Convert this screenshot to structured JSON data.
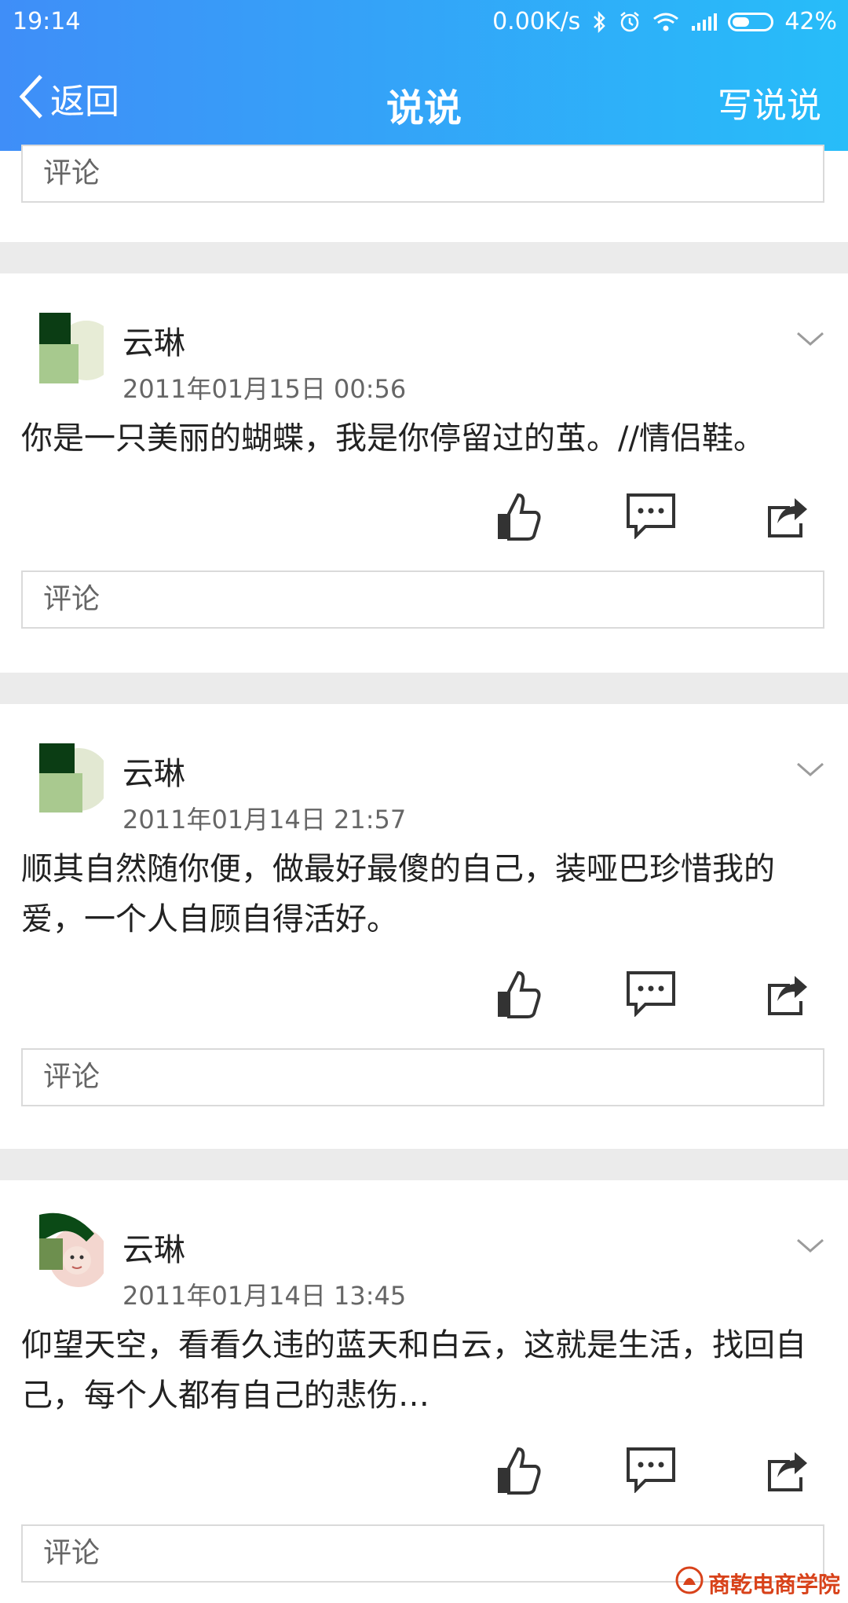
{
  "status": {
    "time": "19:14",
    "speed": "0.00K/s",
    "battery": "42%"
  },
  "nav": {
    "back_label": "返回",
    "title": "说说",
    "write_label": "写说说"
  },
  "comment_placeholder": "评论",
  "posts": [
    {
      "author": "云琳",
      "timestamp": "2011年01月15日 00:56",
      "text": "你是一只美丽的蝴蝶，我是你停留过的茧。//情侣鞋。"
    },
    {
      "author": "云琳",
      "timestamp": "2011年01月14日 21:57",
      "text": "顺其自然随你便，做最好最傻的自己，装哑巴珍惜我的爱，一个人自顾自得活好。"
    },
    {
      "author": "云琳",
      "timestamp": "2011年01月14日 13:45",
      "text": "仰望天空，看看久违的蓝天和白云，这就是生活，找回自己，每个人都有自己的悲伤…"
    }
  ],
  "watermark": "商乾电商学院",
  "colors": {
    "header_start": "#3f8ef8",
    "header_end": "#27bdf9",
    "separator": "#ebebeb"
  }
}
